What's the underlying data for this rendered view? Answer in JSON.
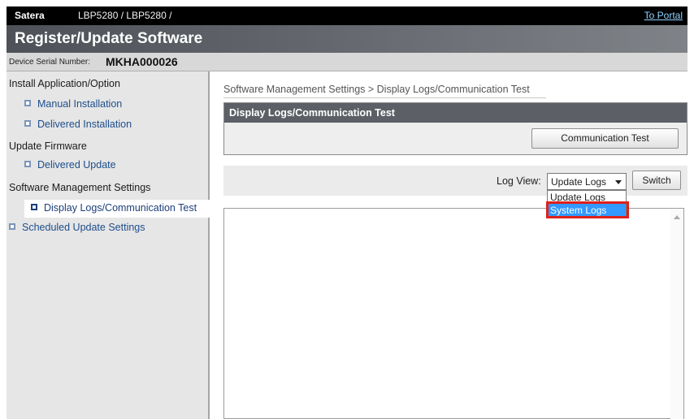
{
  "header": {
    "brand": "Satera",
    "model": "LBP5280 / LBP5280 /",
    "portal_link": "To Portal"
  },
  "title": "Register/Update Software",
  "serial": {
    "label": "Device Serial Number:",
    "value": "MKHA000026"
  },
  "sidebar": {
    "sections": [
      {
        "label": "Install Application/Option"
      },
      {
        "label": "Update Firmware"
      },
      {
        "label": "Software Management Settings"
      }
    ],
    "items": [
      {
        "label": "Manual Installation",
        "icon": "square-bullet-icon"
      },
      {
        "label": "Delivered Installation",
        "icon": "square-bullet-icon"
      },
      {
        "label": "Delivered Update",
        "icon": "square-bullet-icon"
      },
      {
        "label": "Display Logs/Communication Test",
        "icon": "square-bullet-icon",
        "active": true
      },
      {
        "label": "Scheduled Update Settings",
        "icon": "square-bullet-icon"
      }
    ]
  },
  "main": {
    "breadcrumb": "Software Management Settings > Display Logs/Communication Test",
    "panel_title": "Display Logs/Communication Test",
    "comm_test_button": "Communication Test",
    "log_view_label": "Log View:",
    "log_view_selected": "Update Logs",
    "switch_button": "Switch",
    "log_view_options": [
      "Update Logs",
      "System Logs"
    ],
    "log_view_highlighted": "System Logs"
  },
  "colors": {
    "highlight_box": "#e0201a",
    "dropdown_selection": "#3399ff",
    "top_bar": "#000000",
    "title_bar": "#5c6066"
  }
}
